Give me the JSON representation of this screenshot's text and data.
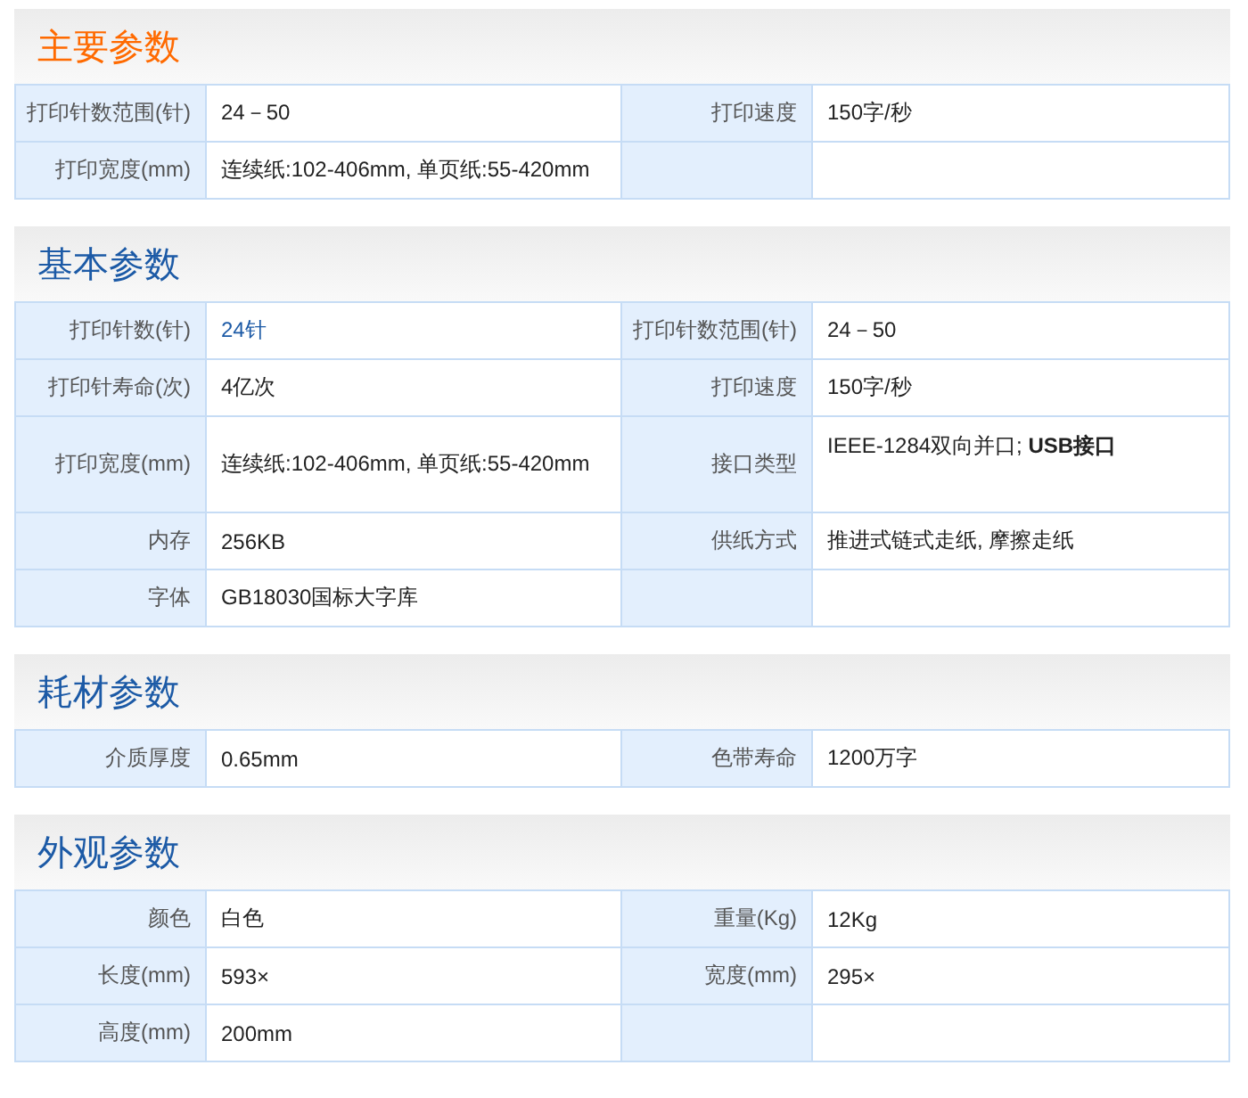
{
  "sections": [
    {
      "title": "主要参数",
      "color": "#ff6a00",
      "rows": [
        {
          "tall": false,
          "pairs": [
            {
              "label": "打印针数范围(针)",
              "value": "24－50"
            },
            {
              "label": "打印速度",
              "value": "150字/秒"
            }
          ]
        },
        {
          "tall": false,
          "pairs": [
            {
              "label": "打印宽度(mm)",
              "value": "连续纸:102-406mm, 单页纸:55-420mm"
            }
          ]
        }
      ]
    },
    {
      "title": "基本参数",
      "color": "#1c5aa6",
      "rows": [
        {
          "tall": false,
          "pairs": [
            {
              "label": "打印针数(针)",
              "value": "24针",
              "link": true
            },
            {
              "label": "打印针数范围(针)",
              "value": "24－50"
            }
          ]
        },
        {
          "tall": false,
          "pairs": [
            {
              "label": "打印针寿命(次)",
              "value": "4亿次"
            },
            {
              "label": "打印速度",
              "value": "150字/秒"
            }
          ]
        },
        {
          "tall": true,
          "pairs": [
            {
              "label": "打印宽度(mm)",
              "value": "连续纸:102-406mm, 单页纸:55-420mm"
            },
            {
              "label": "接口类型",
              "value": "IEEE-1284双向并口; **USB接口**",
              "top": true
            }
          ]
        },
        {
          "tall": false,
          "pairs": [
            {
              "label": "内存",
              "value": "256KB"
            },
            {
              "label": "供纸方式",
              "value": "推进式链式走纸, 摩擦走纸"
            }
          ]
        },
        {
          "tall": false,
          "pairs": [
            {
              "label": "字体",
              "value": "GB18030国标大字库"
            }
          ]
        }
      ]
    },
    {
      "title": "耗材参数",
      "color": "#1c5aa6",
      "rows": [
        {
          "tall": false,
          "pairs": [
            {
              "label": "介质厚度",
              "value": "0.65mm"
            },
            {
              "label": "色带寿命",
              "value": "1200万字"
            }
          ]
        }
      ]
    },
    {
      "title": "外观参数",
      "color": "#1c5aa6",
      "rows": [
        {
          "tall": false,
          "pairs": [
            {
              "label": "颜色",
              "value": "白色"
            },
            {
              "label": "重量(Kg)",
              "value": "12Kg"
            }
          ]
        },
        {
          "tall": false,
          "pairs": [
            {
              "label": "长度(mm)",
              "value": "593×"
            },
            {
              "label": "宽度(mm)",
              "value": "295×"
            }
          ]
        },
        {
          "tall": false,
          "pairs": [
            {
              "label": "高度(mm)",
              "value": "200mm"
            }
          ]
        }
      ]
    }
  ]
}
